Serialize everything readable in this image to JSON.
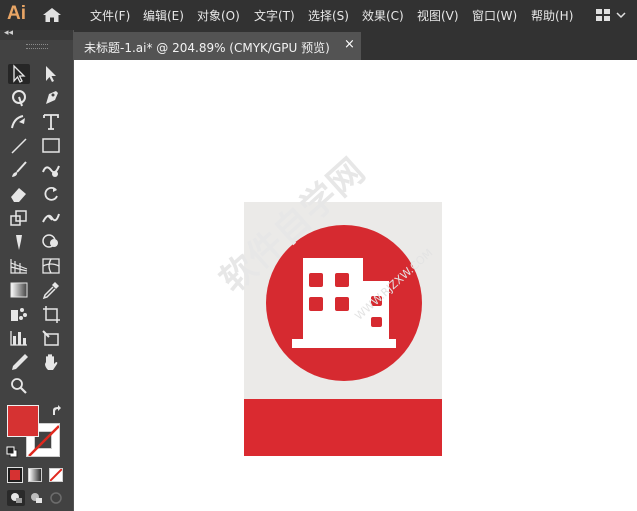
{
  "app": {
    "logo": "Ai"
  },
  "menu": [
    {
      "label": "文件(F)"
    },
    {
      "label": "编辑(E)"
    },
    {
      "label": "对象(O)"
    },
    {
      "label": "文字(T)"
    },
    {
      "label": "选择(S)"
    },
    {
      "label": "效果(C)"
    },
    {
      "label": "视图(V)"
    },
    {
      "label": "窗口(W)"
    },
    {
      "label": "帮助(H)"
    }
  ],
  "toolbar": {
    "collapse_label": "◂◂"
  },
  "tools": [
    {
      "icon": "selection-tool-icon"
    },
    {
      "icon": "direct-selection-tool-icon"
    },
    {
      "icon": "magic-wand-tool-icon"
    },
    {
      "icon": "pen-tool-icon"
    },
    {
      "icon": "curvature-tool-icon"
    },
    {
      "icon": "type-tool-icon"
    },
    {
      "icon": "line-segment-tool-icon"
    },
    {
      "icon": "rectangle-tool-icon"
    },
    {
      "icon": "paintbrush-tool-icon"
    },
    {
      "icon": "shaper-tool-icon"
    },
    {
      "icon": "eraser-tool-icon"
    },
    {
      "icon": "rotate-tool-icon"
    },
    {
      "icon": "scale-tool-icon"
    },
    {
      "icon": "width-tool-icon"
    },
    {
      "icon": "puppet-warp-tool-icon"
    },
    {
      "icon": "shape-builder-tool-icon"
    },
    {
      "icon": "perspective-grid-tool-icon"
    },
    {
      "icon": "mesh-tool-icon"
    },
    {
      "icon": "gradient-tool-icon"
    },
    {
      "icon": "eyedropper-tool-icon"
    },
    {
      "icon": "symbol-sprayer-tool-icon"
    },
    {
      "icon": "artboard-tool-icon"
    },
    {
      "icon": "column-graph-tool-icon"
    },
    {
      "icon": "slice-tool-icon"
    },
    {
      "icon": "pencil-tool-icon"
    },
    {
      "icon": "hand-tool-icon"
    },
    {
      "icon": "zoom-tool-icon"
    }
  ],
  "colors": {
    "fill": "#d63232",
    "stroke": "none",
    "accent": "#e8a565"
  },
  "document": {
    "tab_title": "未标题-1.ai* @ 204.89% (CMYK/GPU 预览)",
    "close_label": "×"
  },
  "artwork": {
    "background": "#ebeae8",
    "circle": "#d62a30",
    "bar": "#da2a30",
    "building": "#ffffff",
    "subject": "building-icon"
  },
  "watermark": {
    "text": "软件自学网",
    "url": "WWW.RJZXW.COM"
  }
}
